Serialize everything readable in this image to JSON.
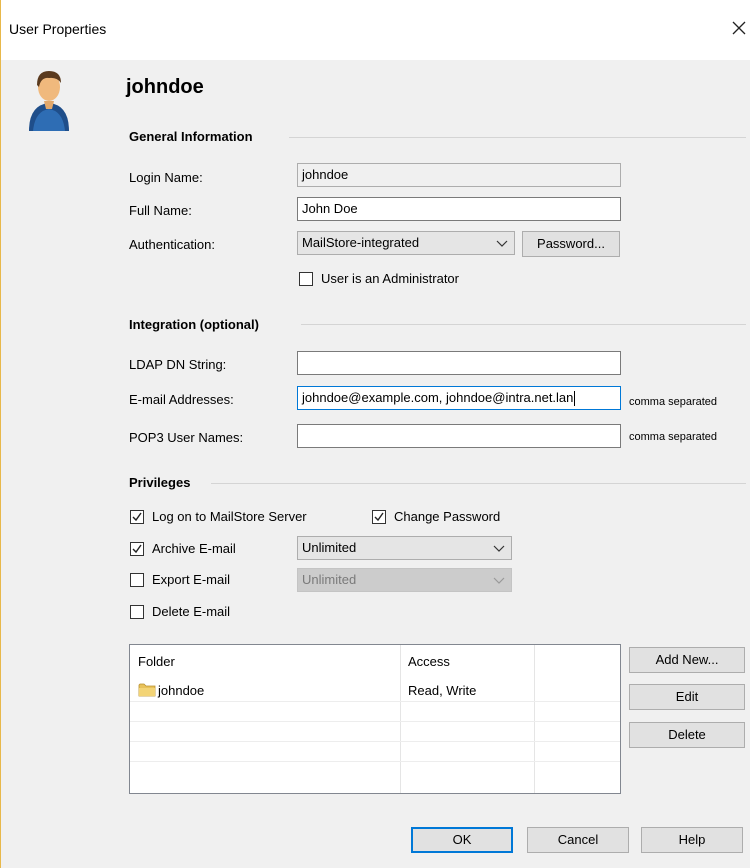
{
  "window": {
    "title": "User Properties",
    "close_glyph": "✕"
  },
  "header": {
    "username": "johndoe",
    "avatar_icon": "user-avatar-icon"
  },
  "general": {
    "heading": "General Information",
    "login_label": "Login Name:",
    "login_value": "johndoe",
    "fullname_label": "Full Name:",
    "fullname_value": "John Doe",
    "auth_label": "Authentication:",
    "auth_value": "MailStore-integrated",
    "password_button": "Password...",
    "admin_label": "User is an Administrator",
    "admin_checked": false
  },
  "integration": {
    "heading": "Integration (optional)",
    "ldap_label": "LDAP DN String:",
    "ldap_value": "",
    "email_label": "E-mail Addresses:",
    "email_value": "johndoe@example.com, johndoe@intra.net.lan",
    "email_hint": "comma separated",
    "pop3_label": "POP3 User Names:",
    "pop3_value": "",
    "pop3_hint": "comma separated"
  },
  "privileges": {
    "heading": "Privileges",
    "logon_label": "Log on to MailStore Server",
    "logon_checked": true,
    "change_password_label": "Change Password",
    "change_password_checked": true,
    "archive_label": "Archive E-mail",
    "archive_checked": true,
    "archive_limit": "Unlimited",
    "export_label": "Export E-mail",
    "export_checked": false,
    "export_limit": "Unlimited",
    "delete_label": "Delete E-mail",
    "delete_checked": false
  },
  "folders": {
    "columns": [
      "Folder",
      "Access"
    ],
    "rows": [
      {
        "folder": "johndoe",
        "access": "Read, Write"
      }
    ],
    "add_button": "Add New...",
    "edit_button": "Edit",
    "delete_button": "Delete"
  },
  "footer": {
    "ok": "OK",
    "cancel": "Cancel",
    "help": "Help"
  },
  "colors": {
    "accent": "#0078d7",
    "window_bg": "#f0f0f0",
    "frame": "#e8b84a"
  }
}
